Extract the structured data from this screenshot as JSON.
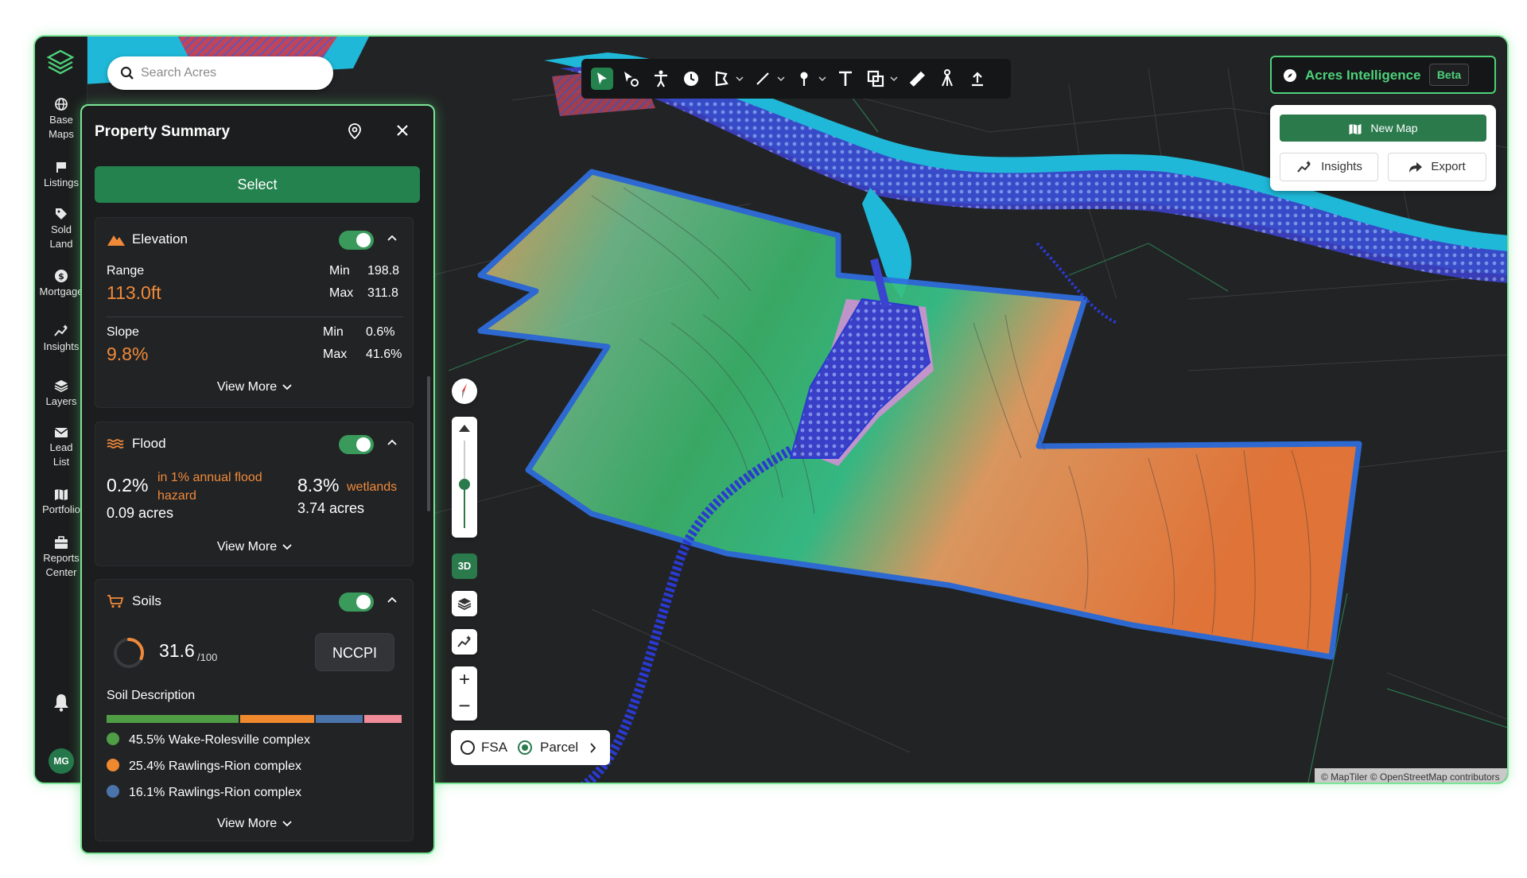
{
  "rail": {
    "items": [
      {
        "label_1": "Base",
        "label_2": "Maps",
        "icon": "globe-icon"
      },
      {
        "label_1": "Listings",
        "label_2": "",
        "icon": "flag-icon"
      },
      {
        "label_1": "Sold",
        "label_2": "Land",
        "icon": "tag-icon"
      },
      {
        "label_1": "Mortgage",
        "label_2": "",
        "icon": "dollar-icon"
      },
      {
        "label_1": "Insights",
        "label_2": "",
        "icon": "sparkle-chart-icon"
      },
      {
        "label_1": "Layers",
        "label_2": "",
        "icon": "layers-icon"
      },
      {
        "label_1": "Lead",
        "label_2": "List",
        "icon": "mail-icon"
      },
      {
        "label_1": "Portfolio",
        "label_2": "",
        "icon": "map-icon"
      },
      {
        "label_1": "Reports",
        "label_2": "Center",
        "icon": "briefcase-icon"
      }
    ],
    "avatar": "MG"
  },
  "search": {
    "placeholder": "Search Acres"
  },
  "panel": {
    "title": "Property Summary",
    "select_label": "Select",
    "elevation": {
      "title": "Elevation",
      "range_label": "Range",
      "range_value": "113.0ft",
      "range_min_label": "Min",
      "range_min": "198.8",
      "range_max_label": "Max",
      "range_max": "311.8",
      "slope_label": "Slope",
      "slope_value": "9.8%",
      "slope_min_label": "Min",
      "slope_min": "0.6%",
      "slope_max_label": "Max",
      "slope_max": "41.6%",
      "view_more": "View More"
    },
    "flood": {
      "title": "Flood",
      "flood_pct": "0.2%",
      "flood_desc_1": "in 1% annual flood",
      "flood_desc_2": "hazard",
      "flood_acres": "0.09 acres",
      "wet_pct": "8.3%",
      "wet_desc": "wetlands",
      "wet_acres": "3.74 acres",
      "view_more": "View More"
    },
    "soils": {
      "title": "Soils",
      "score": "31.6",
      "score_unit": "/100",
      "score_fraction": 0.316,
      "badge": "NCCPI",
      "desc_label": "Soil Description",
      "bar": [
        {
          "pct": 45.5,
          "color": "#4f9d45"
        },
        {
          "pct": 25.4,
          "color": "#f0892e"
        },
        {
          "pct": 16.1,
          "color": "#4a74aa"
        },
        {
          "pct": 13.0,
          "color": "#f08c9a"
        }
      ],
      "legend": [
        {
          "text": "45.5% Wake-Rolesville complex",
          "color": "#4f9d45"
        },
        {
          "text": "25.4% Rawlings-Rion complex",
          "color": "#f0892e"
        },
        {
          "text": "16.1% Rawlings-Rion complex",
          "color": "#4a74aa"
        }
      ],
      "view_more": "View More"
    }
  },
  "acres_intelligence": {
    "label": "Acres Intelligence",
    "badge": "Beta",
    "new_map": "New Map",
    "insights": "Insights",
    "export": "Export"
  },
  "map_controls": {
    "three_d": "3D",
    "fsa": "FSA",
    "parcel": "Parcel"
  },
  "attribution": "© MapTiler © OpenStreetMap contributors",
  "colors": {
    "accent": "#24824f",
    "highlight": "#4dd27a",
    "orange": "#f08a3a"
  }
}
